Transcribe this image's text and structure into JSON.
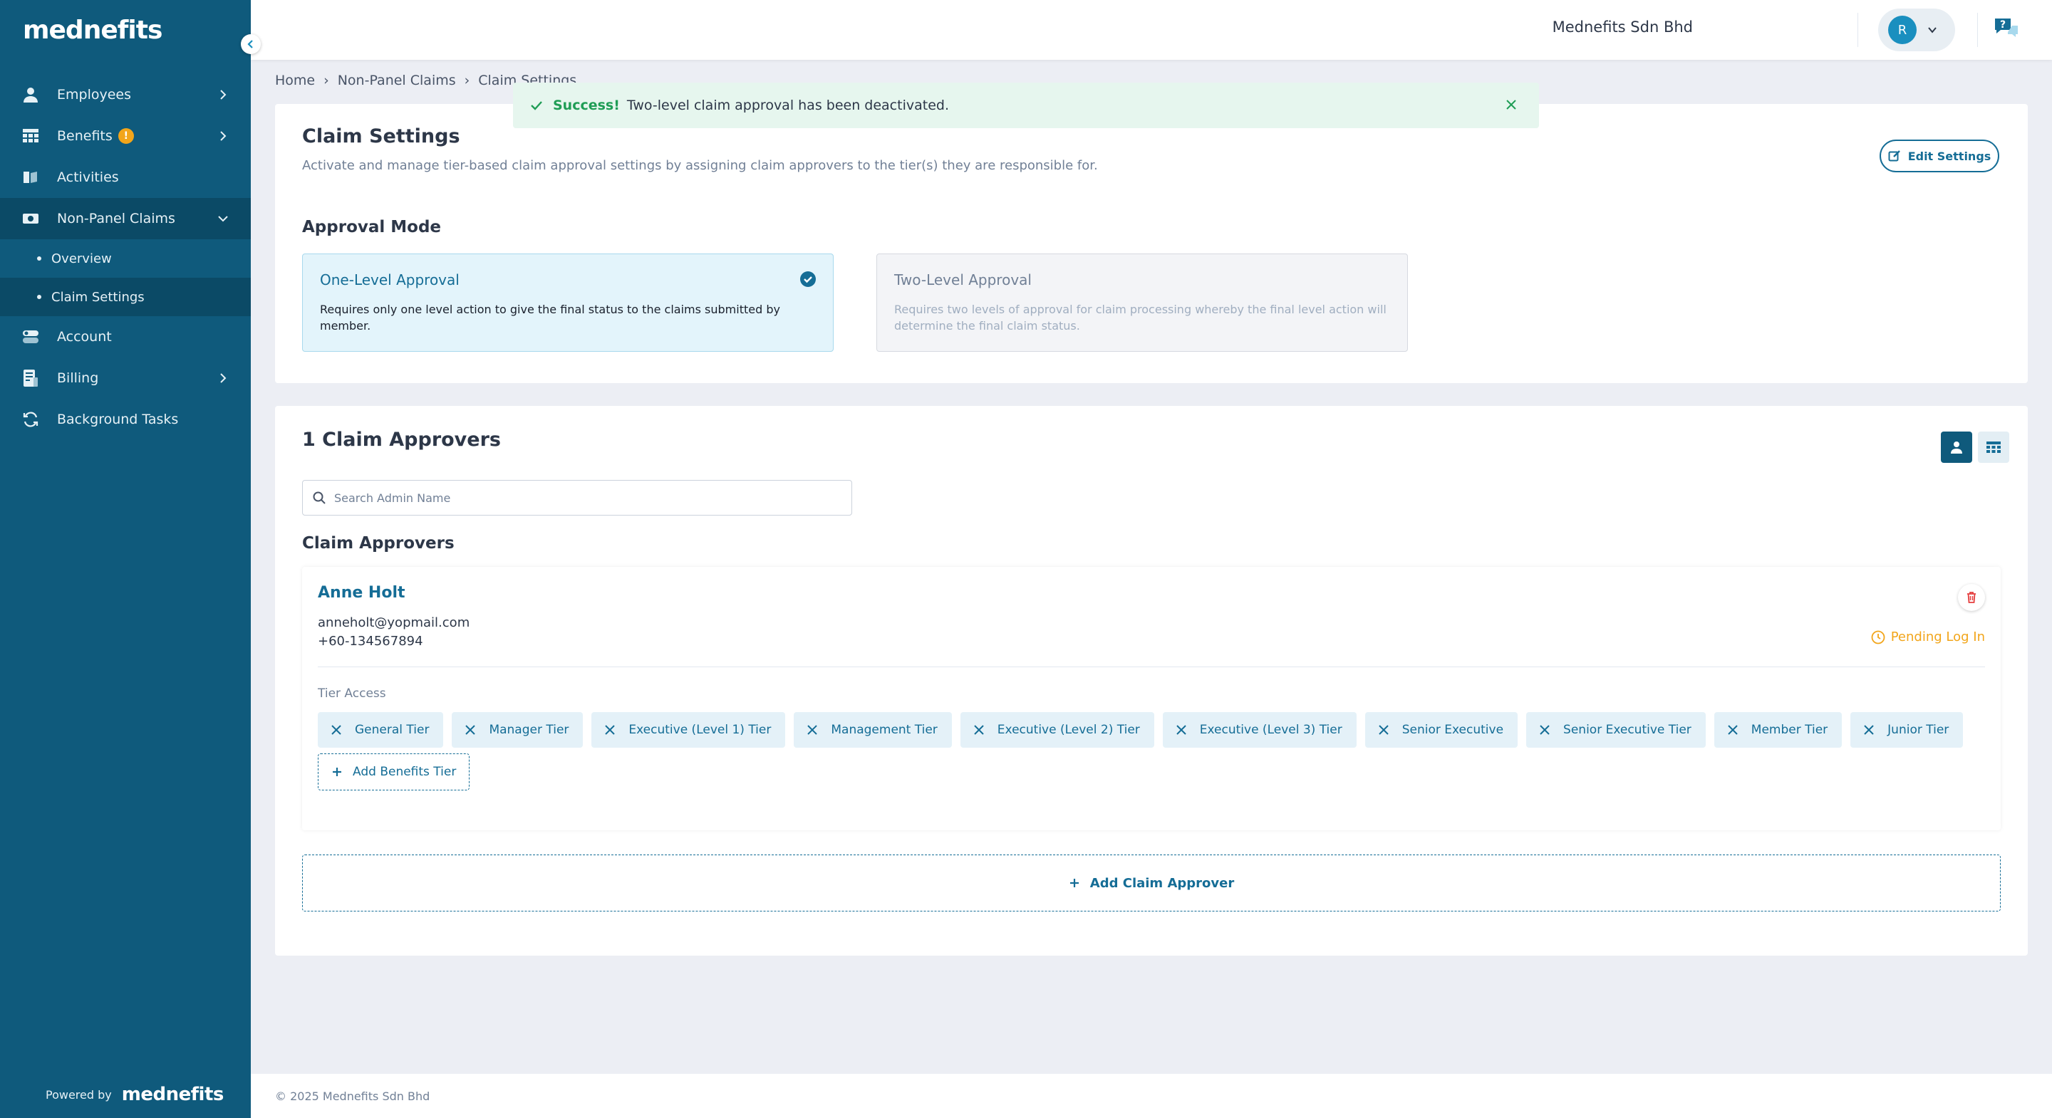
{
  "brand": {
    "logo": "mednefits",
    "powered_by": "Powered by",
    "accent": "#0f5a7c"
  },
  "sidebar": {
    "items": [
      {
        "label": "Employees",
        "icon": "user-icon"
      },
      {
        "label": "Benefits",
        "icon": "table-icon",
        "badge": "!"
      },
      {
        "label": "Activities",
        "icon": "book-icon"
      },
      {
        "label": "Non-Panel Claims",
        "icon": "receipt-icon"
      },
      {
        "label": "Account",
        "icon": "account-icon"
      },
      {
        "label": "Billing",
        "icon": "billing-icon"
      },
      {
        "label": "Background Tasks",
        "icon": "refresh-icon"
      }
    ],
    "sub_items": [
      {
        "label": "Overview"
      },
      {
        "label": "Claim Settings"
      }
    ]
  },
  "topbar": {
    "company": "Mednefits Sdn Bhd",
    "avatar_initial": "R"
  },
  "breadcrumb": [
    "Home",
    "Non-Panel Claims",
    "Claim Settings"
  ],
  "toast": {
    "status": "Success!",
    "message": "Two-level claim approval has been deactivated."
  },
  "claim_settings": {
    "title": "Claim Settings",
    "description": "Activate and manage tier-based claim approval settings by assigning claim approvers to the tier(s) they are responsible for.",
    "edit_button": "Edit Settings",
    "approval_mode_label": "Approval Mode",
    "modes": [
      {
        "title": "One-Level Approval",
        "description": "Requires only one level action to give the final status to the claims submitted by member.",
        "selected": true
      },
      {
        "title": "Two-Level Approval",
        "description": "Requires two levels of approval for claim processing whereby the final level action will determine the final claim status.",
        "selected": false
      }
    ]
  },
  "approvers": {
    "count_title": "1 Claim Approvers",
    "search_placeholder": "Search Admin Name",
    "section_label": "Claim Approvers",
    "list": [
      {
        "name": "Anne Holt",
        "email": "anneholt@yopmail.com",
        "phone": "+60-134567894",
        "status": "Pending Log In",
        "tier_label": "Tier Access",
        "tiers": [
          "General Tier",
          "Manager Tier",
          "Executive (Level 1) Tier",
          "Management Tier",
          "Executive (Level 2) Tier",
          "Executive (Level 3) Tier",
          "Senior Executive",
          "Senior Executive Tier",
          "Member Tier",
          "Junior Tier"
        ],
        "add_tier_label": "Add Benefits Tier"
      }
    ],
    "add_approver_label": "Add Claim Approver"
  },
  "footer": {
    "copyright": "© 2025 Mednefits Sdn Bhd"
  }
}
